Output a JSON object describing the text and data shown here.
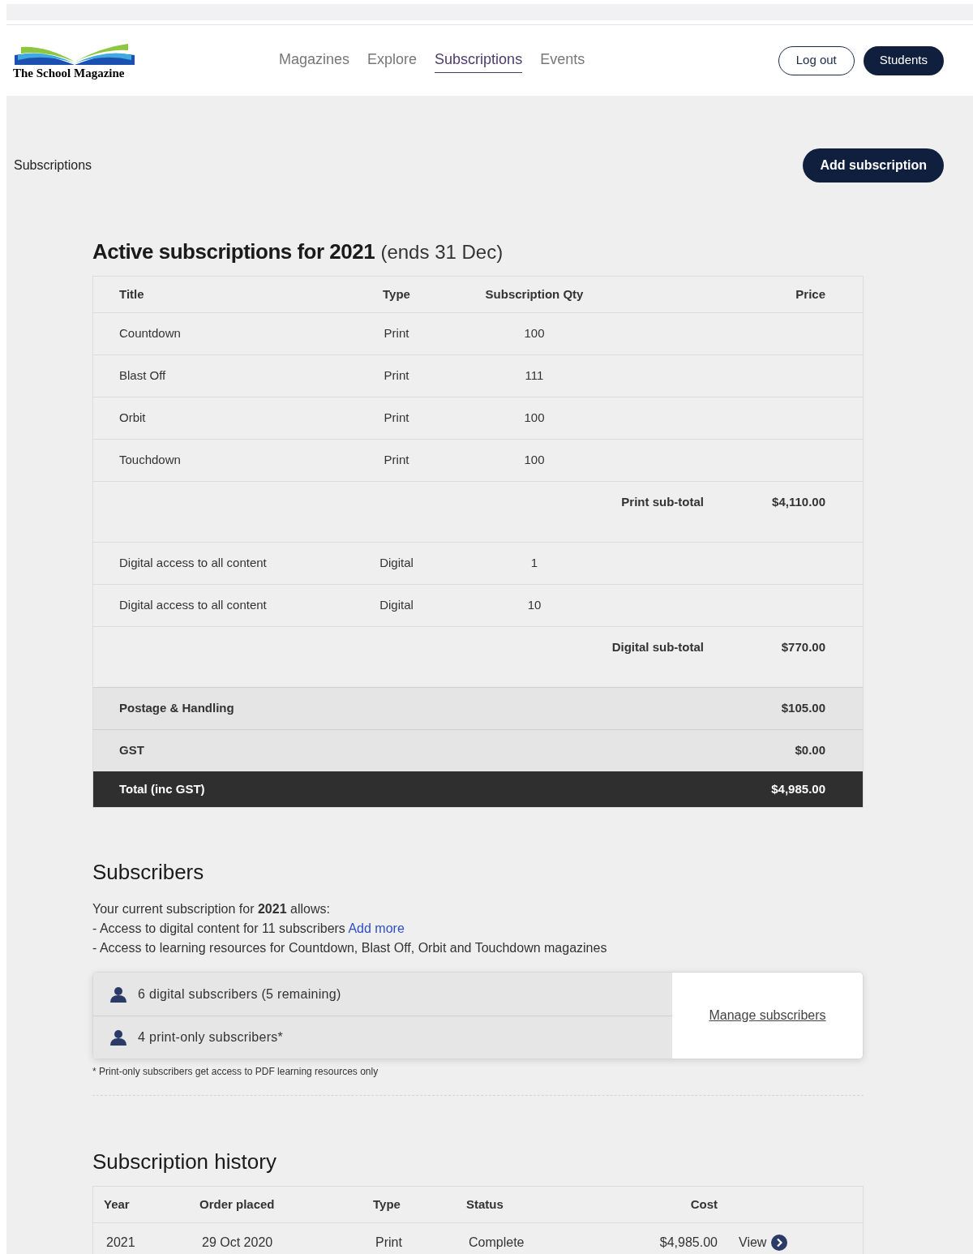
{
  "header": {
    "logo_text": "The School Magazine",
    "nav": [
      {
        "label": "Magazines",
        "selected": false
      },
      {
        "label": "Explore",
        "selected": false
      },
      {
        "label": "Subscriptions",
        "selected": true
      },
      {
        "label": "Events",
        "selected": false
      }
    ],
    "logout": "Log out",
    "students": "Students"
  },
  "page_title": "Subscriptions",
  "add_button": "Add subscription",
  "active": {
    "title": "Active subscriptions for 2021",
    "title_note": "(ends 31 Dec)",
    "columns": [
      "Title",
      "Type",
      "Subscription Qty",
      "Price"
    ],
    "rows": [
      {
        "kind": "item",
        "title": "Countdown",
        "type": "Print",
        "qty": "100"
      },
      {
        "kind": "item",
        "title": "Blast Off",
        "type": "Print",
        "qty": "111"
      },
      {
        "kind": "item",
        "title": "Orbit",
        "type": "Print",
        "qty": "100"
      },
      {
        "kind": "item",
        "title": "Touchdown",
        "type": "Print",
        "qty": "100"
      },
      {
        "kind": "subtotal",
        "label": "Print sub-total",
        "price": "$4,110.00"
      },
      {
        "kind": "item",
        "title": "Digital access to all content",
        "type": "Digital",
        "qty": "1"
      },
      {
        "kind": "item",
        "title": "Digital access to all content",
        "type": "Digital",
        "qty": "10"
      },
      {
        "kind": "subtotal",
        "label": "Digital sub-total",
        "price": "$770.00"
      },
      {
        "kind": "fee",
        "label": "Postage & Handling",
        "price": "$105.00"
      },
      {
        "kind": "fee",
        "label": "GST",
        "price": "$0.00"
      },
      {
        "kind": "total",
        "label": "Total (inc GST)",
        "price": "$4,985.00"
      }
    ]
  },
  "subscribers": {
    "title": "Subscribers",
    "intro": "Your current subscription for **2021** allows:",
    "line_1": "- Access to digital content for 11 subscribers",
    "line_1_link": "Add more",
    "line_2": "- Access to learning resources for Countdown, Blast Off, Orbit and Touchdown magazines",
    "counts": [
      "6 digital subscribers (5 remaining)",
      "4 print-only subscribers*"
    ],
    "manage": "Manage subscribers",
    "footnote": "* Print-only subscribers get access to PDF learning resources only"
  },
  "history": {
    "title": "Subscription history",
    "columns": [
      "Year",
      "Order placed",
      "Type",
      "Status",
      "Cost"
    ],
    "rows": [
      {
        "year": "2021",
        "order_placed": "29 Oct 2020",
        "type": "Print",
        "status": "Complete",
        "cost": "$4,985.00",
        "action": "View"
      }
    ]
  }
}
